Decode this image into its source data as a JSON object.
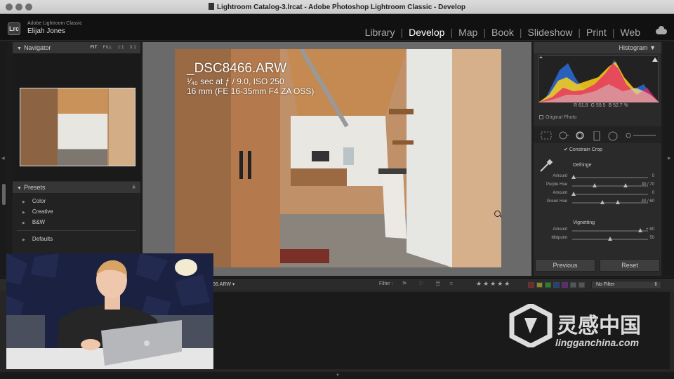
{
  "window": {
    "title": "Lightroom Catalog-3.lrcat - Adobe Photoshop Lightroom Classic - Develop"
  },
  "identity": {
    "logo": "Lrc",
    "app_name": "Adobe Lightroom Classic",
    "user_name": "Elijah Jones"
  },
  "modules": [
    {
      "label": "Library",
      "active": false
    },
    {
      "label": "Develop",
      "active": true
    },
    {
      "label": "Map",
      "active": false
    },
    {
      "label": "Book",
      "active": false
    },
    {
      "label": "Slideshow",
      "active": false
    },
    {
      "label": "Print",
      "active": false
    },
    {
      "label": "Web",
      "active": false
    }
  ],
  "navigator": {
    "title": "Navigator",
    "zoom_fit": "FIT",
    "zoom_fill": "FILL",
    "zoom_1_1": "1:1",
    "zoom_3_1": "3:1"
  },
  "presets": {
    "title": "Presets",
    "add": "+",
    "items": [
      "Color",
      "Creative",
      "B&W"
    ],
    "defaults": "Defaults"
  },
  "photo_info": {
    "filename": "_DSC8466.ARW",
    "exposure_prefix": "¹⁄₄₀",
    "exposure_rest": "sec at ƒ / 9.0, ISO 250",
    "lens": "16 mm (FE 16-35mm F4 ZA OSS)"
  },
  "histogram": {
    "title": "Histogram",
    "r_label": "R",
    "r_value": "61.8",
    "g_label": "G",
    "g_value": "59.5",
    "b_label": "B",
    "b_value": "52.7",
    "unit": "%",
    "original_photo": "Original Photo"
  },
  "crop": {
    "constrain_label": "Constrain Crop"
  },
  "defringe": {
    "title": "Defringe",
    "rows": [
      {
        "label": "Amount",
        "value": "0",
        "pos": 0.02
      },
      {
        "label": "Purple Hue",
        "value": "30 / 70",
        "pos": 0.3,
        "pos2": 0.7
      },
      {
        "label": "Amount",
        "value": "0",
        "pos": 0.02
      },
      {
        "label": "Green Hue",
        "value": "40 / 60",
        "pos": 0.4,
        "pos2": 0.6
      }
    ]
  },
  "vignetting": {
    "title": "Vignetting",
    "rows": [
      {
        "label": "Amount",
        "value": "+ 80",
        "pos": 0.9
      },
      {
        "label": "Midpoint",
        "value": "50",
        "pos": 0.5
      }
    ]
  },
  "buttons": {
    "previous": "Previous",
    "reset": "Reset"
  },
  "filmstrip": {
    "filename": "66.ARW ▾",
    "filter_label": "Filter :",
    "stars": "★★★★★",
    "no_filter": "No Filter",
    "colors": [
      "#8a2020",
      "#8a8a20",
      "#208a20",
      "#20408a",
      "#6a208a",
      "#555555",
      "#555555"
    ]
  },
  "watermark": {
    "text": "灵感中国",
    "url": "lingganchina.com"
  }
}
